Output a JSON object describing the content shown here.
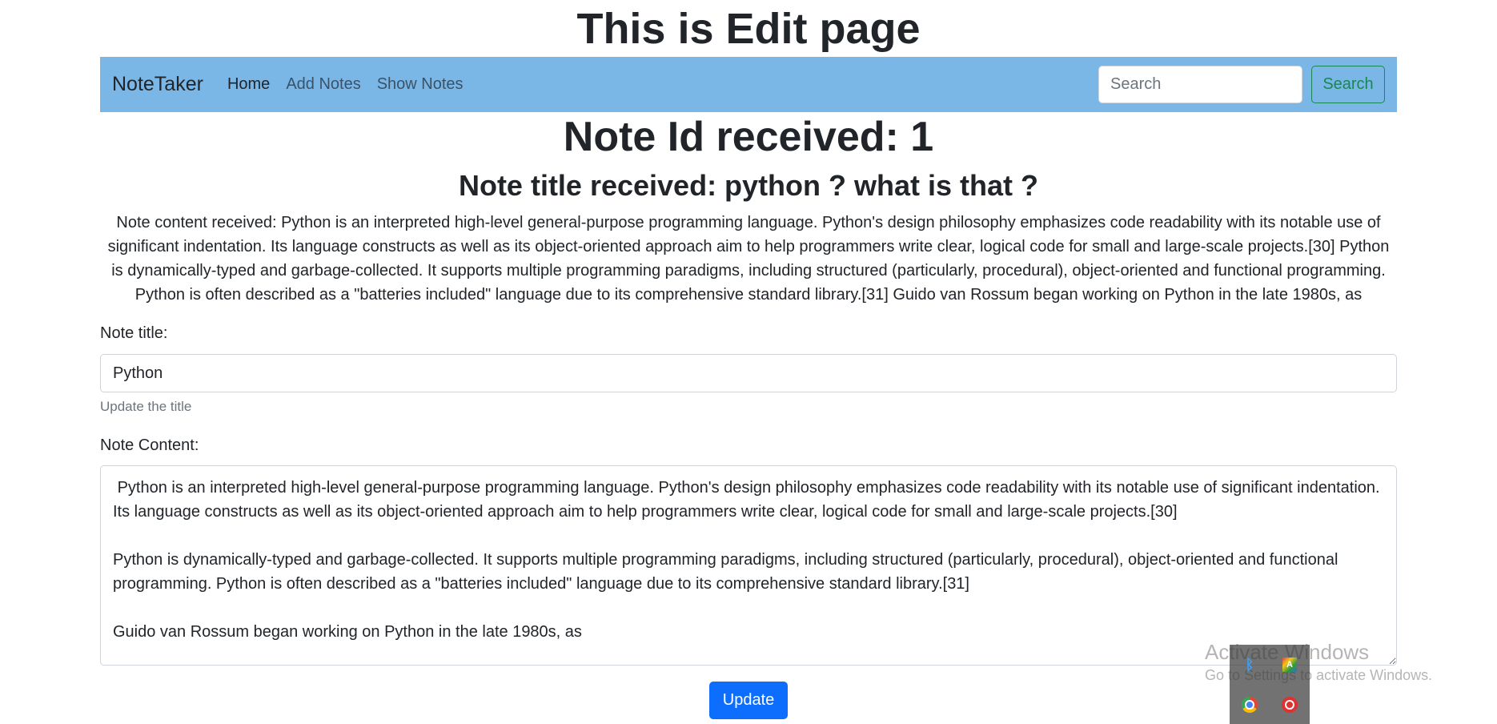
{
  "page": {
    "heading": "This is Edit page"
  },
  "navbar": {
    "brand": "NoteTaker",
    "links": [
      "Home",
      "Add Notes",
      "Show Notes"
    ],
    "search_placeholder": "Search",
    "search_button": "Search"
  },
  "received": {
    "id_line": "Note Id received: 1",
    "title_line": "Note title received: python ? what is that ?",
    "content_line": "Note content received: Python is an interpreted high-level general-purpose programming language. Python's design philosophy emphasizes code readability with its notable use of significant indentation. Its language constructs as well as its object-oriented approach aim to help programmers write clear, logical code for small and large-scale projects.[30] Python is dynamically-typed and garbage-collected. It supports multiple programming paradigms, including structured (particularly, procedural), object-oriented and functional programming. Python is often described as a \"batteries included\" language due to its comprehensive standard library.[31] Guido van Rossum began working on Python in the late 1980s, as"
  },
  "form": {
    "title_label": "Note title:",
    "title_value": "Python",
    "title_help": "Update the title",
    "content_label": "Note Content:",
    "content_value": " Python is an interpreted high-level general-purpose programming language. Python's design philosophy emphasizes code readability with its notable use of significant indentation. Its language constructs as well as its object-oriented approach aim to help programmers write clear, logical code for small and large-scale projects.[30]\n\nPython is dynamically-typed and garbage-collected. It supports multiple programming paradigms, including structured (particularly, procedural), object-oriented and functional programming. Python is often described as a \"batteries included\" language due to its comprehensive standard library.[31]\n\nGuido van Rossum began working on Python in the late 1980s, as",
    "update_button": "Update"
  },
  "os_overlay": {
    "watermark_title": "Activate Windows",
    "watermark_sub": "Go to Settings to activate Windows.",
    "tray_icons": [
      "bluetooth-icon",
      "language-icon",
      "chrome-icon",
      "red-circle-icon"
    ],
    "lang_glyph": "A"
  }
}
